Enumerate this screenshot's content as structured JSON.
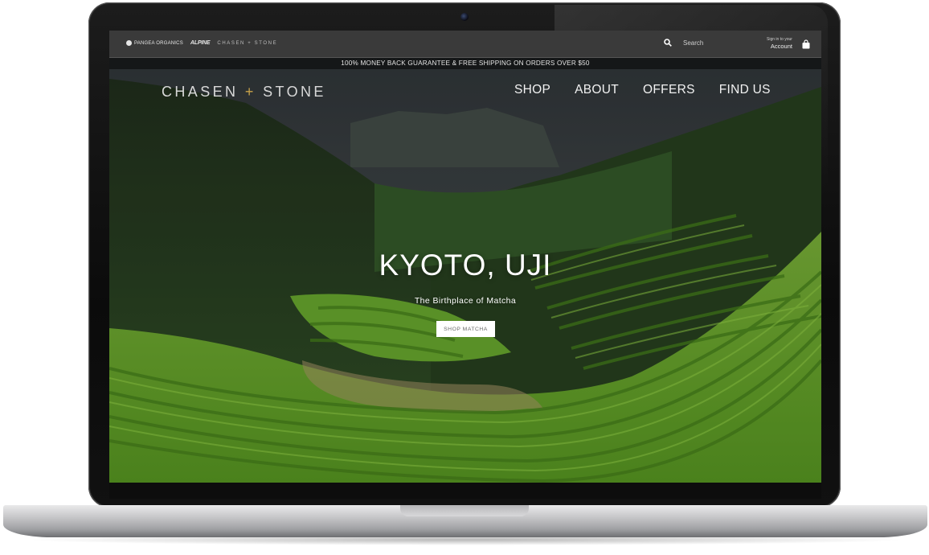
{
  "topbar": {
    "brands": [
      "PANGEA ORGANICS",
      "ALPINE",
      "CHASEN + STONE"
    ],
    "search_placeholder": "Search",
    "account_small": "Sign in to your",
    "account_label": "Account"
  },
  "promo": {
    "text": "100% MONEY BACK GUARANTEE & FREE SHIPPING ON ORDERS OVER $50"
  },
  "logo": {
    "left": "CHASEN",
    "plus": "+",
    "right": "STONE",
    "plus_color": "#c9a24a"
  },
  "nav": {
    "items": [
      "SHOP",
      "ABOUT",
      "OFFERS",
      "FIND US"
    ]
  },
  "hero": {
    "title": "KYOTO, UJI",
    "subtitle": "The Birthplace of Matcha",
    "button": "SHOP MATCHA"
  },
  "icons": [
    "search-icon",
    "bag-icon",
    "globe-icon",
    "camera-icon"
  ]
}
